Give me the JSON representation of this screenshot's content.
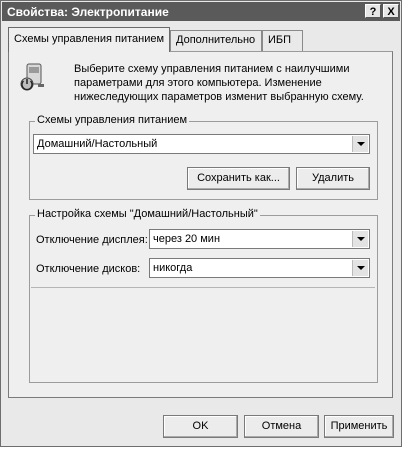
{
  "window": {
    "title": "Свойства: Электропитание",
    "help_button": "?",
    "close_button": "X"
  },
  "tabs": [
    {
      "label": "Схемы управления питанием",
      "active": true
    },
    {
      "label": "Дополнительно",
      "active": false
    },
    {
      "label": "ИБП",
      "active": false
    }
  ],
  "info": {
    "icon": "power-scheme-icon",
    "line1": "Выберите схему управления питанием с наилучшими",
    "line2": "параметрами для этого компьютера. Изменение",
    "line3": "нижеследующих параметров изменит выбранную схему."
  },
  "schemes": {
    "group_label": "Схемы управления питанием",
    "selected": "Домашний/Настольный",
    "save_as_label": "Сохранить как...",
    "delete_label": "Удалить"
  },
  "settings": {
    "group_label": "Настройка схемы \"Домашний/Настольный\"",
    "display_off_label": "Отключение дисплея:",
    "display_off_value": "через 20 мин",
    "disks_off_label": "Отключение дисков:",
    "disks_off_value": "никогда"
  },
  "footer": {
    "ok_label": "OK",
    "cancel_label": "Отмена",
    "apply_label": "Применить"
  },
  "colors": {
    "titlebar": "#5a5a5a",
    "dialog_bg": "#e9e9e9"
  }
}
